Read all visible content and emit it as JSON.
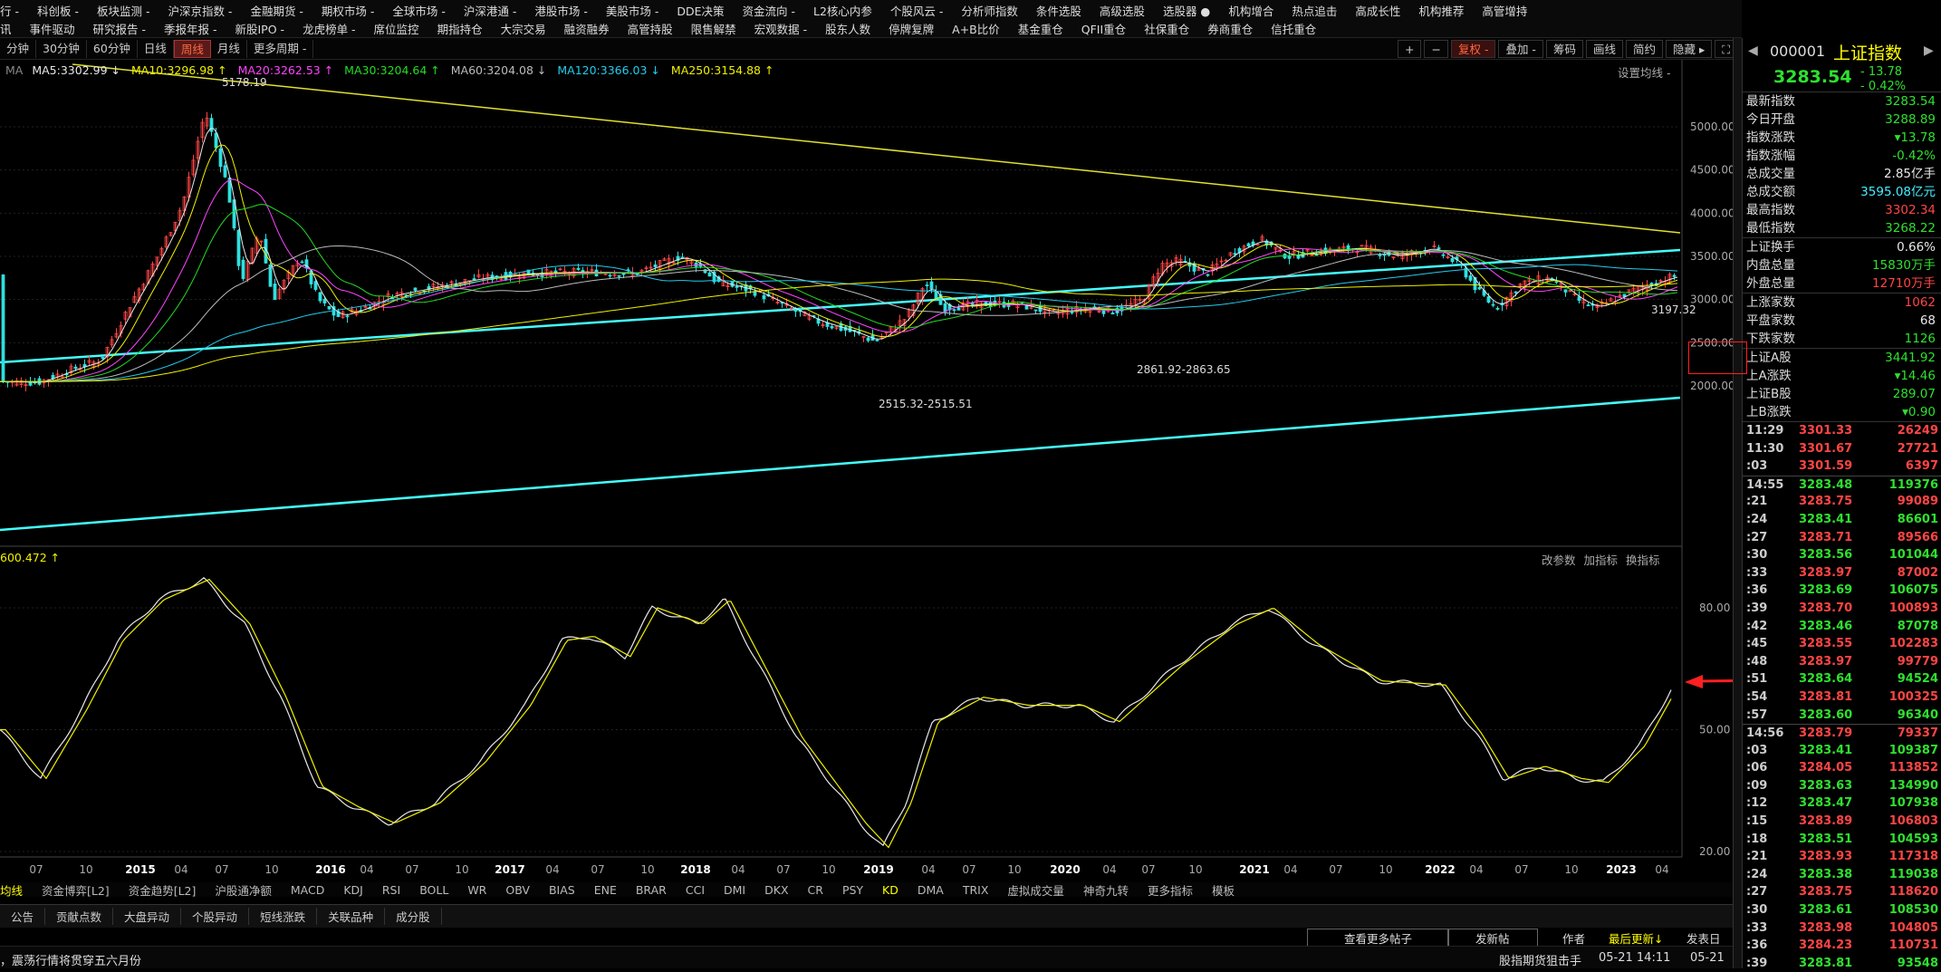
{
  "menu": {
    "row1": [
      "行 -",
      "科创板 -",
      "板块监测 -",
      "沪深京指数 -",
      "金融期货 -",
      "期权市场 -",
      "全球市场 -",
      "沪深港通 -",
      "港股市场 -",
      "美股市场 -",
      "DDE决策",
      "资金流向 -",
      "L2核心内参",
      "个股风云 -",
      "分析师指数",
      "条件选股",
      "高级选股",
      "选股器 ●",
      "机构增合",
      "热点追击",
      "高成长性",
      "机构推荐",
      "高管增持"
    ],
    "row2": [
      "讯",
      "事件驱动",
      "研究报告 -",
      "季报年报 -",
      "新股IPO -",
      "龙虎榜单 -",
      "席位监控",
      "期指持仓",
      "大宗交易",
      "融资融券",
      "高管持股",
      "限售解禁",
      "宏观数据 -",
      "股东人数",
      "停牌复牌",
      "A+B比价",
      "基金重仓",
      "QFII重仓",
      "社保重仓",
      "券商重仓",
      "信托重仓"
    ]
  },
  "toolbar": {
    "periods": [
      "分钟",
      "30分钟",
      "60分钟",
      "日线",
      "周线",
      "月线",
      "更多周期 -"
    ],
    "active": "周线",
    "right": [
      "+",
      "−",
      "复权 -",
      "叠加 -",
      "筹码",
      "画线",
      "简约",
      "隐藏 ▸",
      "⛶"
    ]
  },
  "ma_bar": {
    "label": "MA",
    "items": [
      {
        "text": "MA5:3302.99 ↓",
        "color": "#e8e8e8"
      },
      {
        "text": "MA10:3296.98 ↑",
        "color": "#f0f000"
      },
      {
        "text": "MA20:3262.53 ↑",
        "color": "#ff44ff"
      },
      {
        "text": "MA30:3204.64 ↑",
        "color": "#22dd22"
      },
      {
        "text": "MA60:3204.08 ↓",
        "color": "#bbbbbb"
      },
      {
        "text": "MA120:3366.03 ↓",
        "color": "#22ccee"
      },
      {
        "text": "MA250:3154.88 ↑",
        "color": "#f0f000"
      }
    ],
    "settings": "设置均线 -"
  },
  "price_axis": [
    "5000.00",
    "4500.00",
    "4000.00",
    "3500.00",
    "3000.00",
    "2500.00",
    "2000.00"
  ],
  "annotations": {
    "peak": "5178.19",
    "low1": "2515.32-2515.51",
    "low2": "2861.92-2863.65",
    "last": "3197.32"
  },
  "indicator": {
    "label": "0.472 ↑",
    "label_prefix": "60",
    "buttons": [
      "改参数",
      "加指标",
      "换指标"
    ],
    "axis": [
      "80.00",
      "50.00",
      "20.00"
    ]
  },
  "x_axis": [
    "07",
    "10",
    "2015",
    "04",
    "07",
    "10",
    "2016",
    "04",
    "07",
    "10",
    "2017",
    "04",
    "07",
    "10",
    "2018",
    "04",
    "07",
    "10",
    "2019",
    "04",
    "07",
    "10",
    "2020",
    "04",
    "07",
    "10",
    "2021",
    "04",
    "07",
    "10",
    "2022",
    "04",
    "07",
    "10",
    "2023",
    "04"
  ],
  "tabs": [
    "均线",
    "资金博弈[L2]",
    "资金趋势[L2]",
    "沪股通净额",
    "MACD",
    "KDJ",
    "RSI",
    "BOLL",
    "WR",
    "OBV",
    "BIAS",
    "ENE",
    "BRAR",
    "CCI",
    "DMI",
    "DKX",
    "CR",
    "PSY",
    "KD",
    "DMA",
    "TRIX",
    "虚拟成交量",
    "神奇九转",
    "更多指标",
    "模板"
  ],
  "active_tab": "KD",
  "bottom_tabs": [
    "公告",
    "贡献点数",
    "大盘异动",
    "个股异动",
    "短线涨跌",
    "关联品种",
    "成分股"
  ],
  "news": {
    "headline": "，震荡行情将贯穿五六月份",
    "btn1": "查看更多帖子",
    "btn2": "发新帖",
    "author": "作者",
    "latest": "最后更新↓",
    "post_time": "发表日",
    "futures": "股指期货狙击手",
    "t1": "05-21 14:11",
    "t2": "05-21"
  },
  "side": {
    "code": "000001",
    "name": "上证指数",
    "price": "3283.54",
    "chg": "- 13.78",
    "pct": "- 0.42%",
    "rows": [
      [
        "最新指数",
        "3283.54",
        "g"
      ],
      [
        "今日开盘",
        "3288.89",
        "g"
      ],
      [
        "指数涨跌",
        "▾13.78",
        "g"
      ],
      [
        "指数涨幅",
        "-0.42%",
        "g"
      ],
      [
        "总成交量",
        "2.85亿手",
        "w"
      ],
      [
        "总成交额",
        "3595.08亿元",
        "c"
      ],
      [
        "最高指数",
        "3302.34",
        "r"
      ],
      [
        "最低指数",
        "3268.22",
        "g"
      ]
    ],
    "rows2": [
      [
        "上证换手",
        "0.66%",
        "w"
      ],
      [
        "内盘总量",
        "15830万手",
        "g"
      ],
      [
        "外盘总量",
        "12710万手",
        "r"
      ]
    ],
    "rows3": [
      [
        "上涨家数",
        "1062",
        "r"
      ],
      [
        "平盘家数",
        "68",
        "w"
      ],
      [
        "下跌家数",
        "1126",
        "g"
      ]
    ],
    "rows4": [
      [
        "上证A股",
        "3441.92",
        "g"
      ],
      [
        "上A涨跌",
        "▾14.46",
        "g"
      ],
      [
        "上证B股",
        "289.07",
        "g"
      ],
      [
        "上B涨跌",
        "▾0.90",
        "g"
      ]
    ],
    "ticks": [
      [
        "11:29",
        "3301.33",
        "26249",
        "r"
      ],
      [
        "11:30",
        "3301.67",
        "27721",
        "r"
      ],
      [
        ":03",
        "3301.59",
        "6397",
        "r"
      ],
      [
        "14:55",
        "3283.48",
        "119376",
        "g"
      ],
      [
        ":21",
        "3283.75",
        "99089",
        "r"
      ],
      [
        ":24",
        "3283.41",
        "86601",
        "g"
      ],
      [
        ":27",
        "3283.71",
        "89566",
        "r"
      ],
      [
        ":30",
        "3283.56",
        "101044",
        "g"
      ],
      [
        ":33",
        "3283.97",
        "87002",
        "r"
      ],
      [
        ":36",
        "3283.69",
        "106075",
        "g"
      ],
      [
        ":39",
        "3283.70",
        "100893",
        "r"
      ],
      [
        ":42",
        "3283.46",
        "87078",
        "g"
      ],
      [
        ":45",
        "3283.55",
        "102283",
        "r"
      ],
      [
        ":48",
        "3283.97",
        "99779",
        "r"
      ],
      [
        ":51",
        "3283.64",
        "94524",
        "g"
      ],
      [
        ":54",
        "3283.81",
        "100325",
        "r"
      ],
      [
        ":57",
        "3283.60",
        "96340",
        "g"
      ],
      [
        "14:56",
        "3283.79",
        "79337",
        "r"
      ],
      [
        ":03",
        "3283.41",
        "109387",
        "g"
      ],
      [
        ":06",
        "3284.05",
        "113852",
        "r"
      ],
      [
        ":09",
        "3283.63",
        "134990",
        "g"
      ],
      [
        ":12",
        "3283.47",
        "107938",
        "g"
      ],
      [
        ":15",
        "3283.89",
        "106803",
        "r"
      ],
      [
        ":18",
        "3283.51",
        "104593",
        "g"
      ],
      [
        ":21",
        "3283.93",
        "117318",
        "r"
      ],
      [
        ":24",
        "3283.38",
        "119038",
        "g"
      ],
      [
        ":27",
        "3283.75",
        "118620",
        "r"
      ],
      [
        ":30",
        "3283.61",
        "108530",
        "g"
      ],
      [
        ":33",
        "3283.98",
        "104805",
        "r"
      ],
      [
        ":36",
        "3284.23",
        "110731",
        "r"
      ],
      [
        ":39",
        "3283.81",
        "93548",
        "g"
      ]
    ]
  },
  "colors": {
    "up": "#ff4545",
    "down": "#2fe0e0",
    "trend_cyan": "#4ff",
    "trend_yellow": "#e0e030",
    "kd_k": "#e8e8e8",
    "kd_d": "#f0f000",
    "arrow": "#ff2020"
  }
}
